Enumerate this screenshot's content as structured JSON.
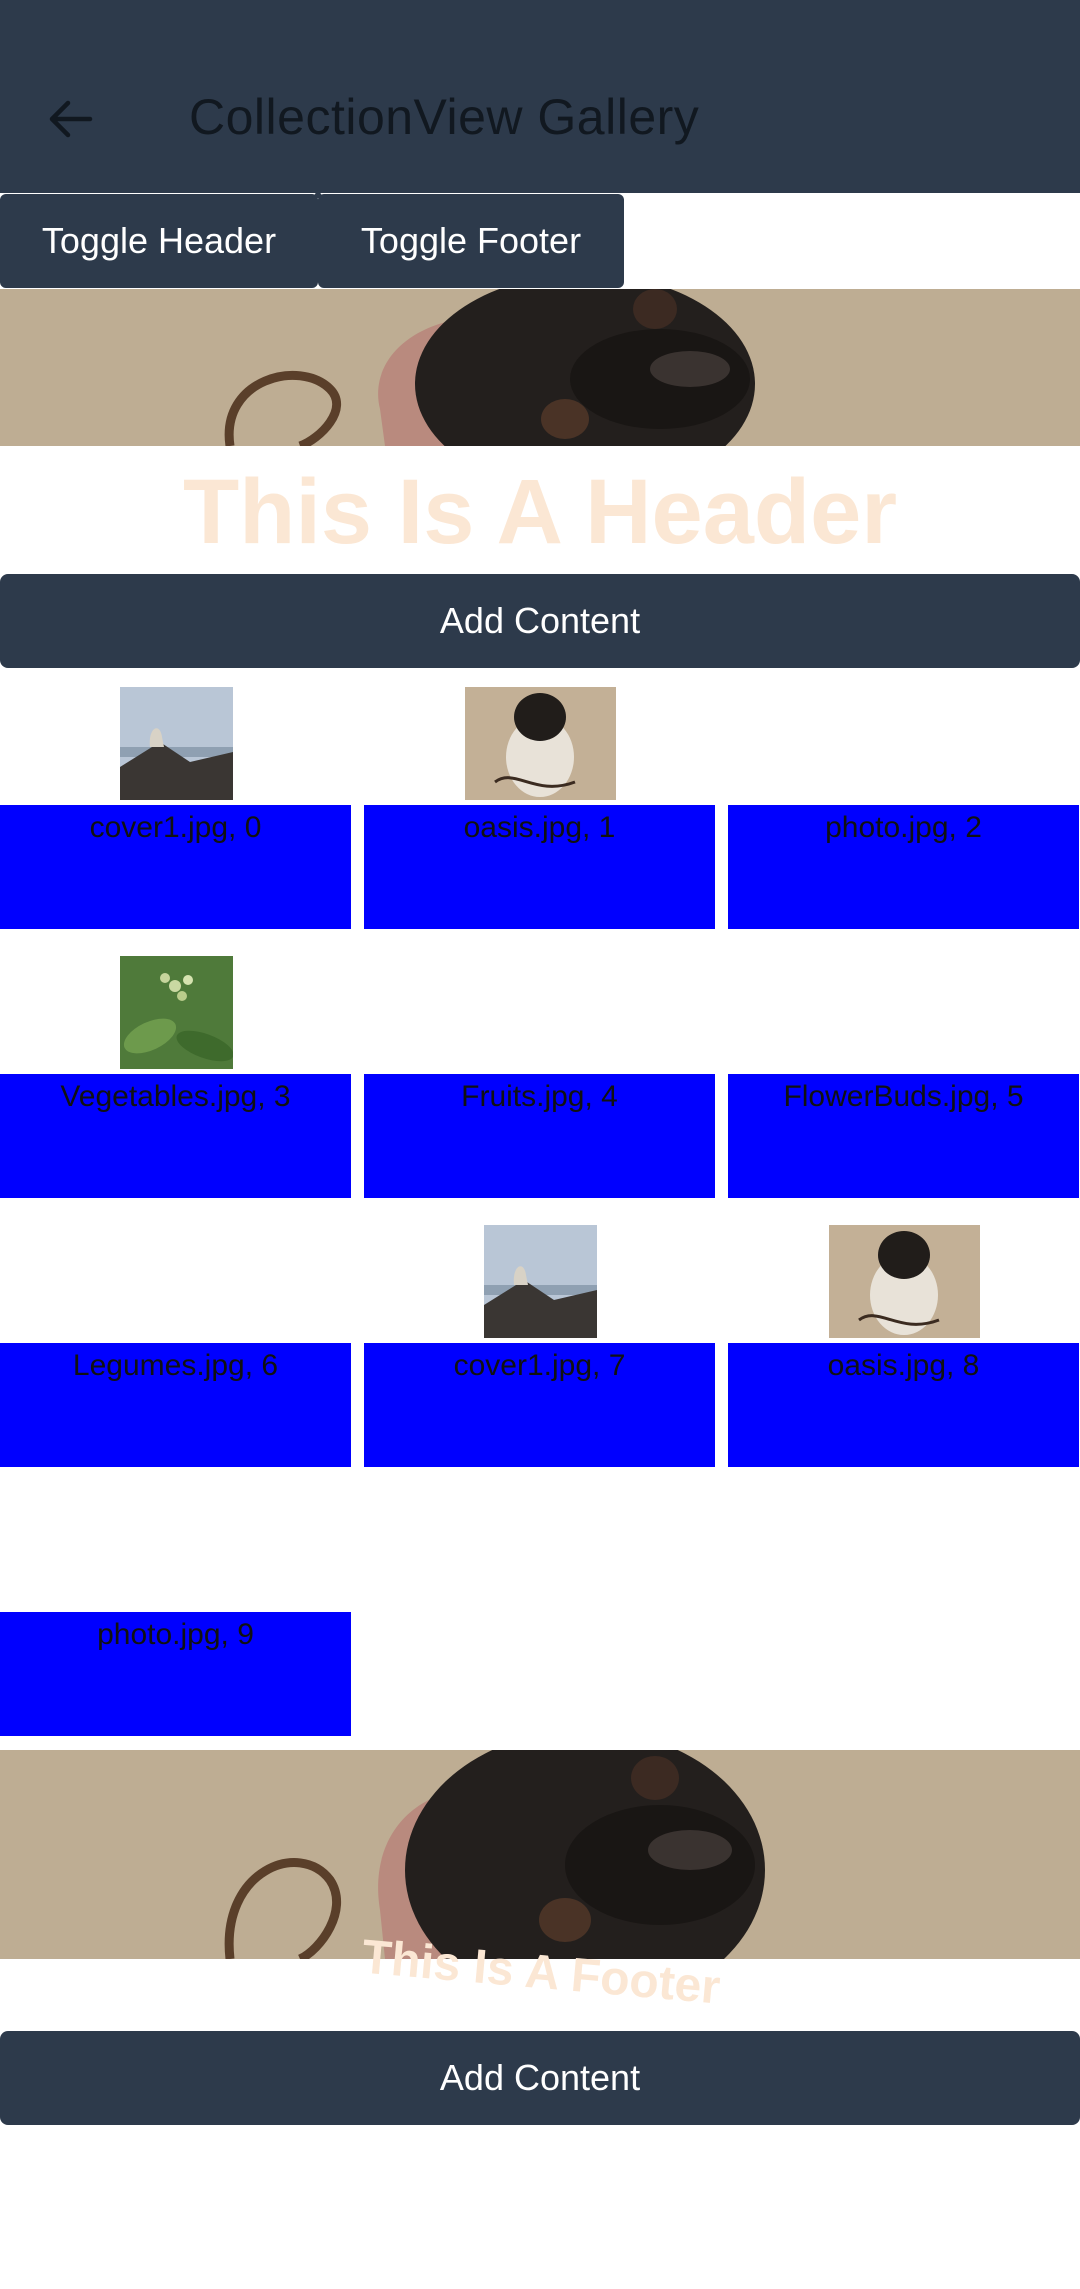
{
  "appbar": {
    "title": "CollectionView Gallery",
    "back_icon": "arrow-left-icon"
  },
  "toolbar": {
    "toggle_header": "Toggle Header",
    "toggle_footer": "Toggle Footer"
  },
  "header": {
    "title": "This Is A Header",
    "add_label": "Add Content"
  },
  "footer": {
    "title": "This Is A Footer",
    "add_label": "Add Content"
  },
  "items": [
    {
      "label": "cover1.jpg, 0",
      "image": "mountain-photo"
    },
    {
      "label": "oasis.jpg, 1",
      "image": "dog-photo"
    },
    {
      "label": "photo.jpg, 2",
      "image": ""
    },
    {
      "label": "Vegetables.jpg, 3",
      "image": "plant-photo"
    },
    {
      "label": "Fruits.jpg, 4",
      "image": ""
    },
    {
      "label": "FlowerBuds.jpg, 5",
      "image": ""
    },
    {
      "label": "Legumes.jpg, 6",
      "image": ""
    },
    {
      "label": "cover1.jpg, 7",
      "image": "mountain-photo"
    },
    {
      "label": "oasis.jpg, 8",
      "image": "dog-photo"
    },
    {
      "label": "photo.jpg, 9",
      "image": ""
    }
  ],
  "colors": {
    "appbar": "#2d3a4b",
    "item_bg": "#0000ff",
    "header_text": "#fbe7d4"
  }
}
